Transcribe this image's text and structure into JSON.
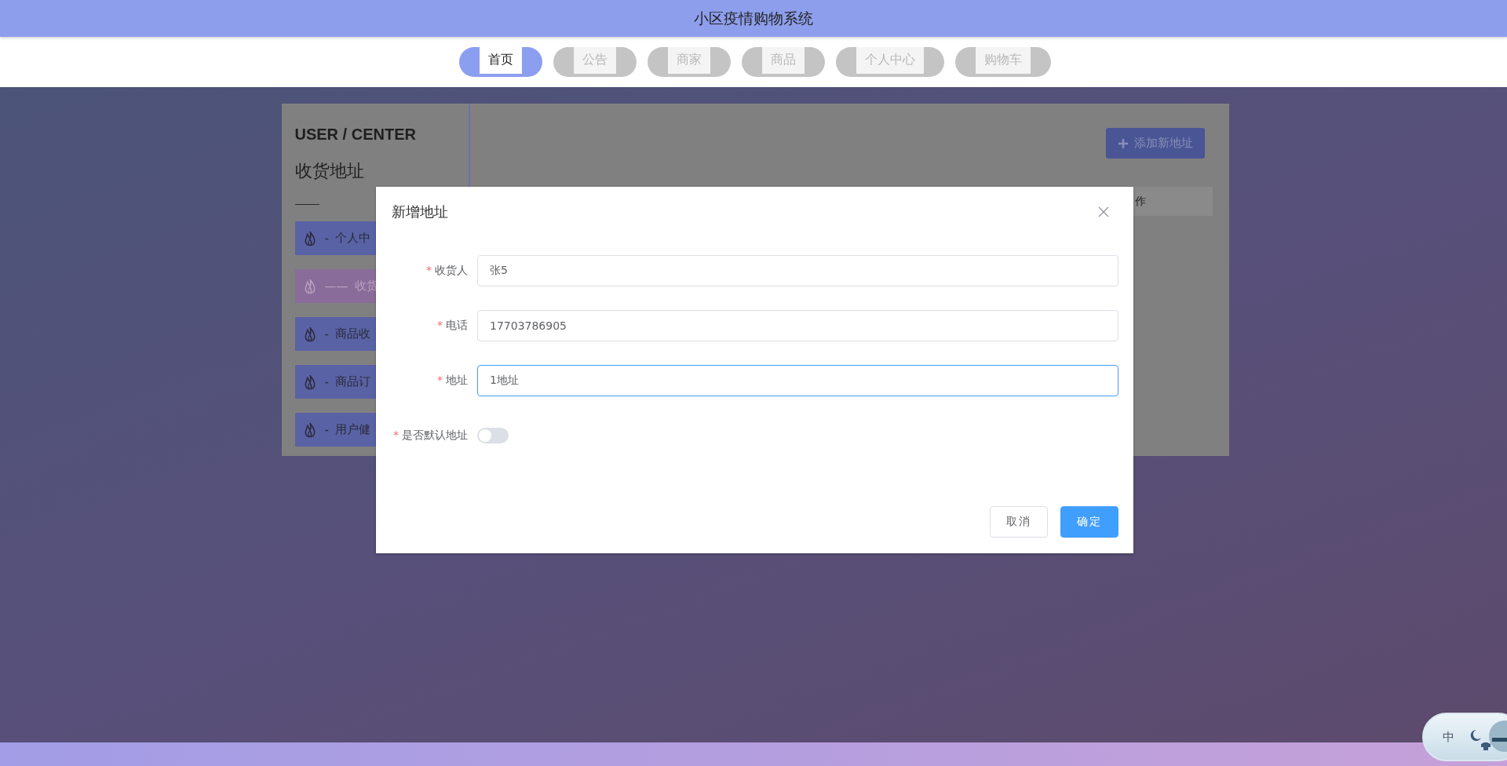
{
  "header": {
    "title": "小区疫情购物系统"
  },
  "nav": [
    {
      "label": "首页",
      "selected": true
    },
    {
      "label": "公告",
      "selected": false
    },
    {
      "label": "商家",
      "selected": false
    },
    {
      "label": "商品",
      "selected": false
    },
    {
      "label": "个人中心",
      "selected": false
    },
    {
      "label": "购物车",
      "selected": false
    }
  ],
  "sidebar": {
    "title": "USER / CENTER",
    "subtitle": "收货地址",
    "items": [
      {
        "prefix": "-",
        "label": "个人中",
        "selected": false
      },
      {
        "prefix": "——",
        "label": "收货",
        "selected": true
      },
      {
        "prefix": "-",
        "label": "商品收",
        "selected": false
      },
      {
        "prefix": "-",
        "label": "商品订",
        "selected": false
      },
      {
        "prefix": "-",
        "label": "用户健",
        "selected": false
      }
    ]
  },
  "content": {
    "add_button": "添加新地址",
    "table_header": "作"
  },
  "dialog": {
    "title": "新增地址",
    "fields": [
      {
        "kind": "text",
        "marker": "*",
        "label": "收货人",
        "value": "张5",
        "focused": false
      },
      {
        "kind": "text",
        "marker": "*",
        "label": "电话",
        "value": "17703786905",
        "focused": false
      },
      {
        "kind": "text",
        "marker": "*",
        "label": "地址",
        "value": "1地址",
        "focused": true
      },
      {
        "kind": "switch",
        "marker": "*",
        "label": "是否默认地址",
        "on": false
      }
    ],
    "buttons": [
      {
        "kind": "default",
        "label": "取消"
      },
      {
        "kind": "primary",
        "label": "确定"
      }
    ]
  },
  "ime": {
    "label": "中"
  }
}
